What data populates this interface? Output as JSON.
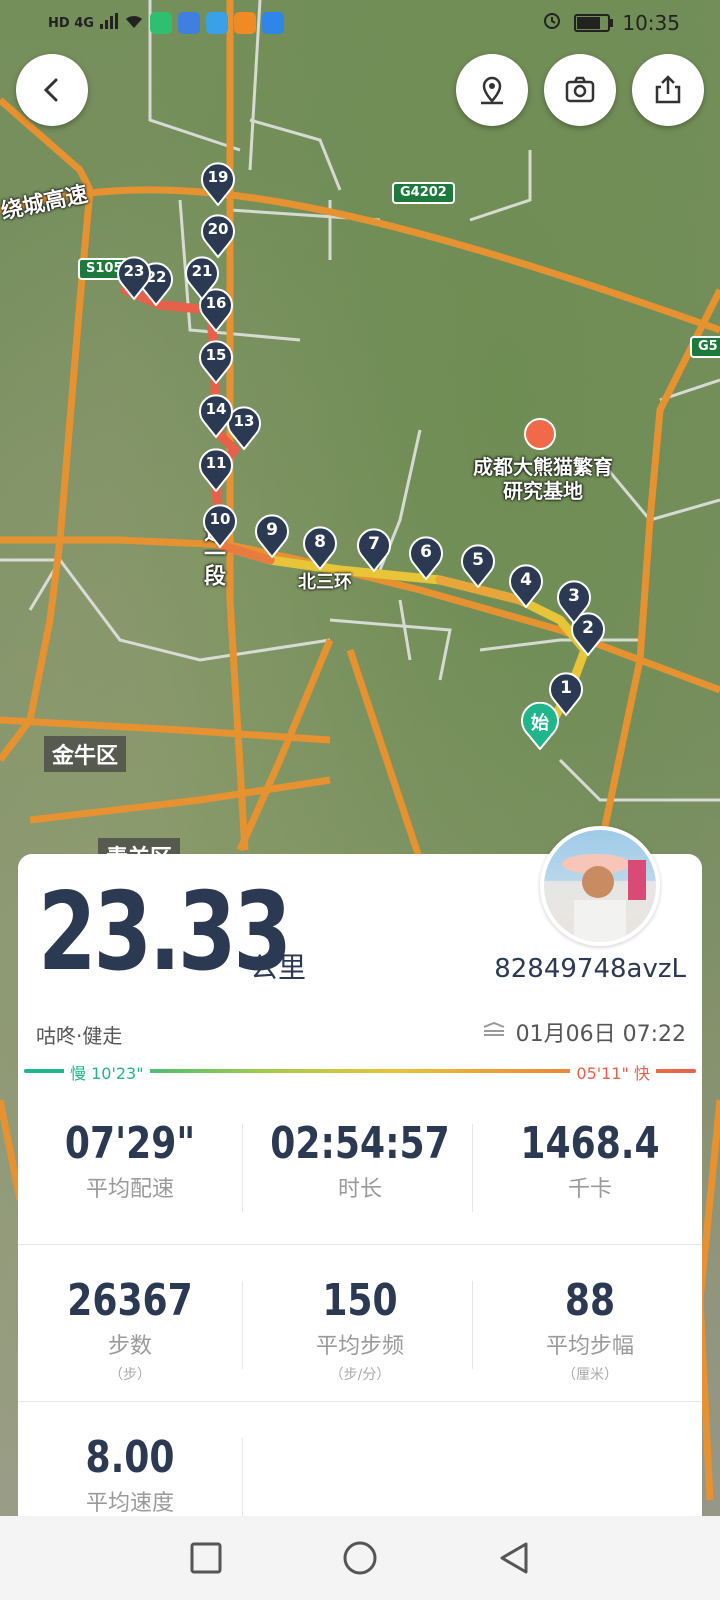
{
  "status_bar": {
    "network": "HD 4G",
    "time": "10:35",
    "battery_level": 0.7
  },
  "map": {
    "labels": {
      "expressway": "绕城高速",
      "road_s": "S105",
      "road_g": "G4202",
      "road_g5": "G5",
      "panda_base": "成都大熊猫繁育研究基地",
      "road_segment": "道一段",
      "road_three": "北三环",
      "district_jinniu": "金牛区",
      "district_qingyang": "青羊区"
    },
    "start_label": "始",
    "checkpoints": [
      "1",
      "2",
      "3",
      "4",
      "5",
      "6",
      "7",
      "8",
      "9",
      "10",
      "11",
      "13",
      "14",
      "15",
      "16",
      "21",
      "20",
      "19",
      "22",
      "23"
    ]
  },
  "card": {
    "distance": "23.33",
    "unit": "公里",
    "username": "82849748avzL",
    "activity": "咕咚·健走",
    "date": "01月06日 07:22",
    "speed_slow_label": "慢 10'23\"",
    "speed_fast_label": "05'11\" 快",
    "stats": [
      {
        "value": "07'29\"",
        "label": "平均配速",
        "sub": ""
      },
      {
        "value": "02:54:57",
        "label": "时长",
        "sub": ""
      },
      {
        "value": "1468.4",
        "label": "千卡",
        "sub": ""
      },
      {
        "value": "26367",
        "label": "步数",
        "sub": "（步）"
      },
      {
        "value": "150",
        "label": "平均步频",
        "sub": "（步/分）"
      },
      {
        "value": "88",
        "label": "平均步幅",
        "sub": "（厘米）"
      },
      {
        "value": "8.00",
        "label": "平均速度",
        "sub": ""
      }
    ]
  },
  "colors": {
    "accent_teal": "#21b58c",
    "route_red": "#e8604a",
    "route_yellow": "#e8c438",
    "marker_dark": "#2b3a52"
  }
}
